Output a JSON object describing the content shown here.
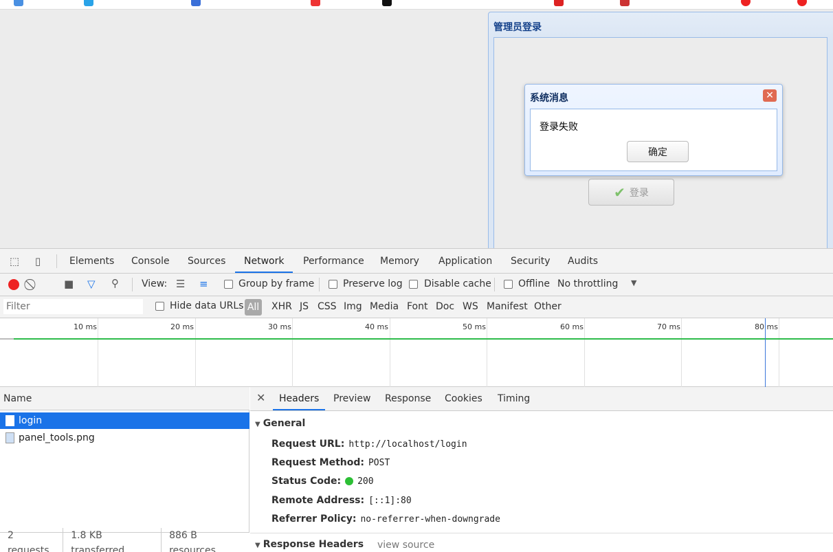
{
  "page": {
    "panel_title": "管理员登录",
    "login_button_label": "登录"
  },
  "dialog": {
    "title": "系统消息",
    "message": "登录失败",
    "ok_label": "确定"
  },
  "devtools": {
    "tabs": [
      "Elements",
      "Console",
      "Sources",
      "Network",
      "Performance",
      "Memory",
      "Application",
      "Security",
      "Audits"
    ],
    "active_tab": "Network",
    "toolbar": {
      "view_label": "View:",
      "group_by_frame": "Group by frame",
      "preserve_log": "Preserve log",
      "disable_cache": "Disable cache",
      "offline": "Offline",
      "throttling": "No throttling"
    },
    "filter": {
      "placeholder": "Filter",
      "hide_data_urls": "Hide data URLs",
      "types": [
        "All",
        "XHR",
        "JS",
        "CSS",
        "Img",
        "Media",
        "Font",
        "Doc",
        "WS",
        "Manifest",
        "Other"
      ]
    },
    "timeline_labels": [
      "10 ms",
      "20 ms",
      "30 ms",
      "40 ms",
      "50 ms",
      "60 ms",
      "70 ms",
      "80 ms"
    ],
    "requests_header": "Name",
    "requests": [
      {
        "name": "login"
      },
      {
        "name": "panel_tools.png"
      }
    ],
    "status": {
      "requests": "2 requests",
      "transferred": "1.8 KB transferred",
      "resources": "886 B resources"
    },
    "detail_tabs": [
      "Headers",
      "Preview",
      "Response",
      "Cookies",
      "Timing"
    ],
    "general": {
      "title": "General",
      "request_url_label": "Request URL:",
      "request_url": "http://localhost/login",
      "request_method_label": "Request Method:",
      "request_method": "POST",
      "status_code_label": "Status Code:",
      "status_code": "200",
      "remote_address_label": "Remote Address:",
      "remote_address": "[::1]:80",
      "referrer_policy_label": "Referrer Policy:",
      "referrer_policy": "no-referrer-when-downgrade"
    },
    "response_headers": {
      "title": "Response Headers",
      "view_source": "view source"
    }
  }
}
